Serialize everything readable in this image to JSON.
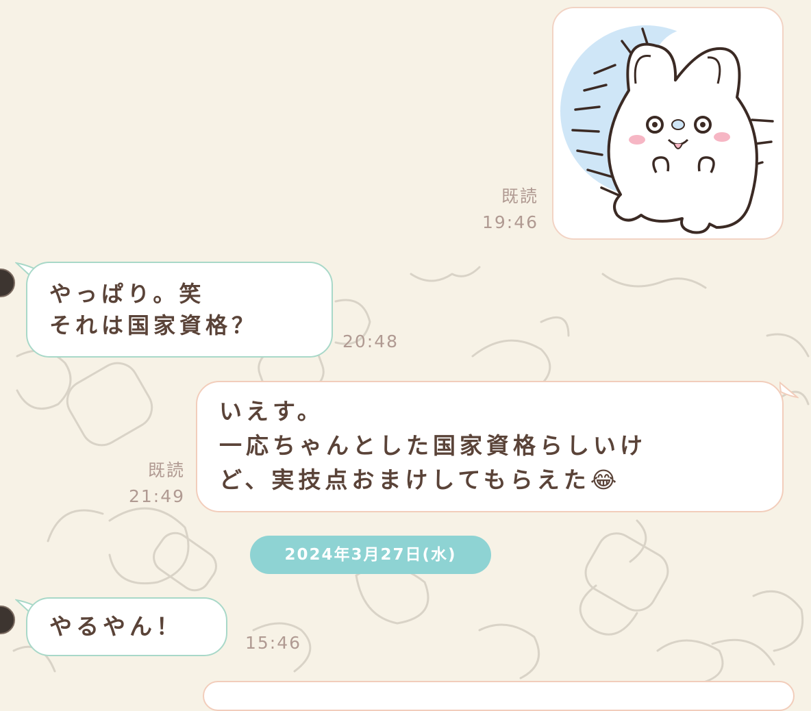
{
  "sticker": {
    "icon": "chiikawa-hamster-sticker-icon"
  },
  "messages": [
    {
      "id": "m1",
      "kind": "sticker",
      "direction": "sent",
      "read": "既読",
      "time": "19:46"
    },
    {
      "id": "m2",
      "direction": "received",
      "lines": [
        "やっぱり。笑",
        "それは国家資格？"
      ],
      "time": "20:48"
    },
    {
      "id": "m3",
      "direction": "sent",
      "lines": [
        "いえす。",
        "一応ちゃんとした国家資格らしいけ",
        "ど、実技点おまけしてもらえた😂"
      ],
      "read": "既読",
      "time": "21:49"
    },
    {
      "id": "m4",
      "direction": "received",
      "lines": [
        "やるやん！"
      ],
      "time": "15:46"
    }
  ],
  "date_separator": "2024年3月27日(水)",
  "colors": {
    "background": "#f7f2e6",
    "received_border": "#a8d8c8",
    "sent_border": "#f2cdbb",
    "date_pill": "#8ed3d3",
    "text": "#5a4338",
    "meta": "#b09a92"
  }
}
